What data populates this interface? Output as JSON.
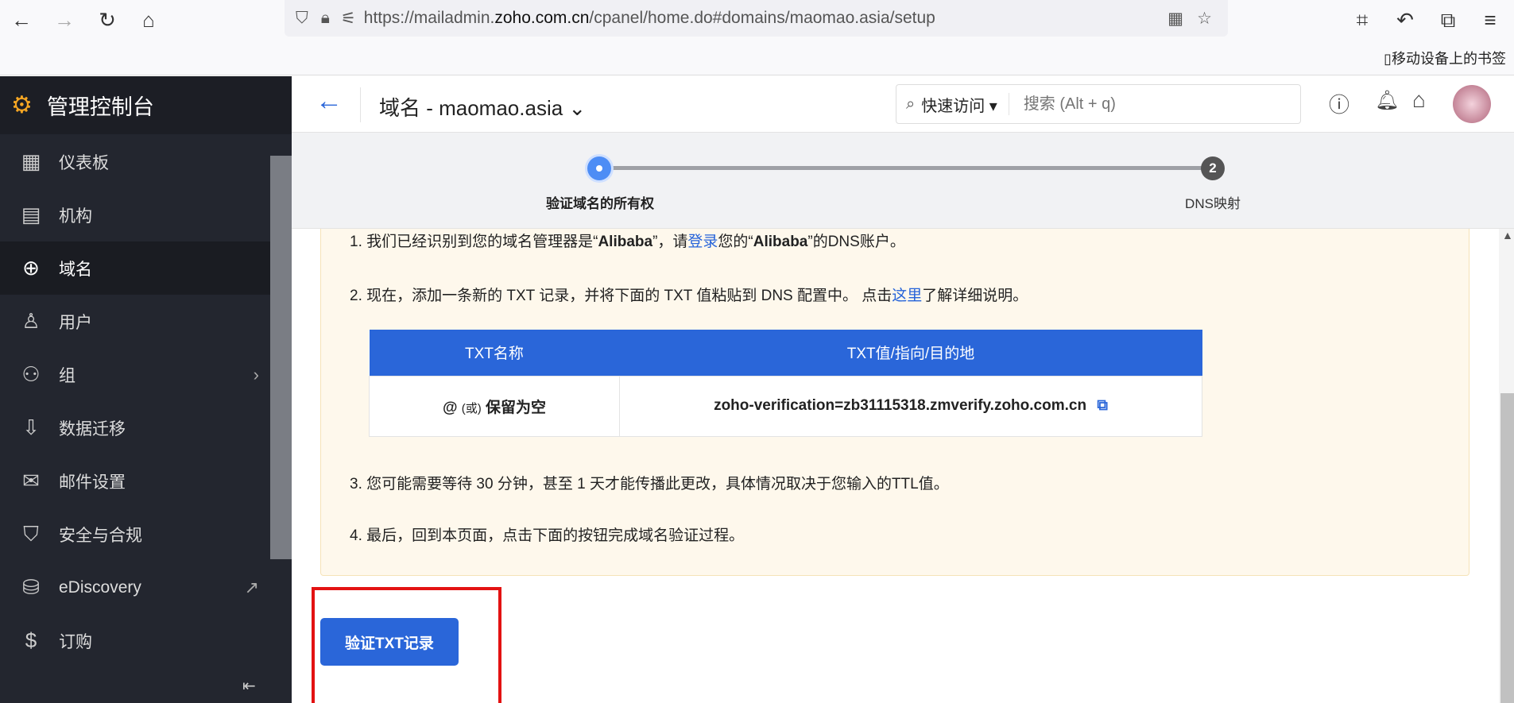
{
  "browser": {
    "url_prefix": "https://mailadmin.",
    "url_domain": "zoho.com.cn",
    "url_path": "/cpanel/home.do#domains/maomao.asia/setup",
    "bookmark": "移动设备上的书签"
  },
  "sidebar": {
    "title": "管理控制台",
    "items": [
      {
        "label": "仪表板",
        "icon": "dashboard-icon"
      },
      {
        "label": "机构",
        "icon": "building-icon"
      },
      {
        "label": "域名",
        "icon": "globe-icon"
      },
      {
        "label": "用户",
        "icon": "user-icon"
      },
      {
        "label": "组",
        "icon": "group-icon"
      },
      {
        "label": "数据迁移",
        "icon": "download-icon"
      },
      {
        "label": "邮件设置",
        "icon": "mail-settings-icon"
      },
      {
        "label": "安全与合规",
        "icon": "shield-icon"
      },
      {
        "label": "eDiscovery",
        "icon": "ediscovery-icon"
      },
      {
        "label": "订购",
        "icon": "billing-icon"
      }
    ]
  },
  "header": {
    "title": "域名 - maomao.asia",
    "quick_access": "快速访问",
    "search_placeholder": "搜索 (Alt + q)"
  },
  "stepper": {
    "steps": [
      {
        "label": "验证域名的所有权",
        "number": "1"
      },
      {
        "label": "DNS映射",
        "number": "2"
      }
    ],
    "current": 1
  },
  "content": {
    "step1_a": "1. 我们已经识别到您的域名管理器是“",
    "provider": "Alibaba",
    "step1_b": "”，请",
    "login": "登录",
    "step1_c": "您的“",
    "step1_d": "”的DNS账户。",
    "step2_a": "2. 现在，添加一条新的 TXT 记录，并将下面的 TXT 值粘贴到 DNS 配置中。 点击",
    "here": "这里",
    "step2_b": "了解详细说明。",
    "table": {
      "col1": "TXT名称",
      "col2": "TXT值/指向/目的地",
      "name_at": "@",
      "name_or": "(或)",
      "name_empty": "保留为空",
      "value": "zoho-verification=zb31115318.zmverify.zoho.com.cn"
    },
    "step3": "3. 您可能需要等待 30 分钟，甚至 1 天才能传播此更改，具体情况取决于您输入的TTL值。",
    "step4": "4. 最后，回到本页面，点击下面的按钮完成域名验证过程。",
    "verify_button": "验证TXT记录"
  },
  "colors": {
    "accent": "#2a66d9",
    "sidebar": "#23262f",
    "highlight": "#e31212"
  }
}
